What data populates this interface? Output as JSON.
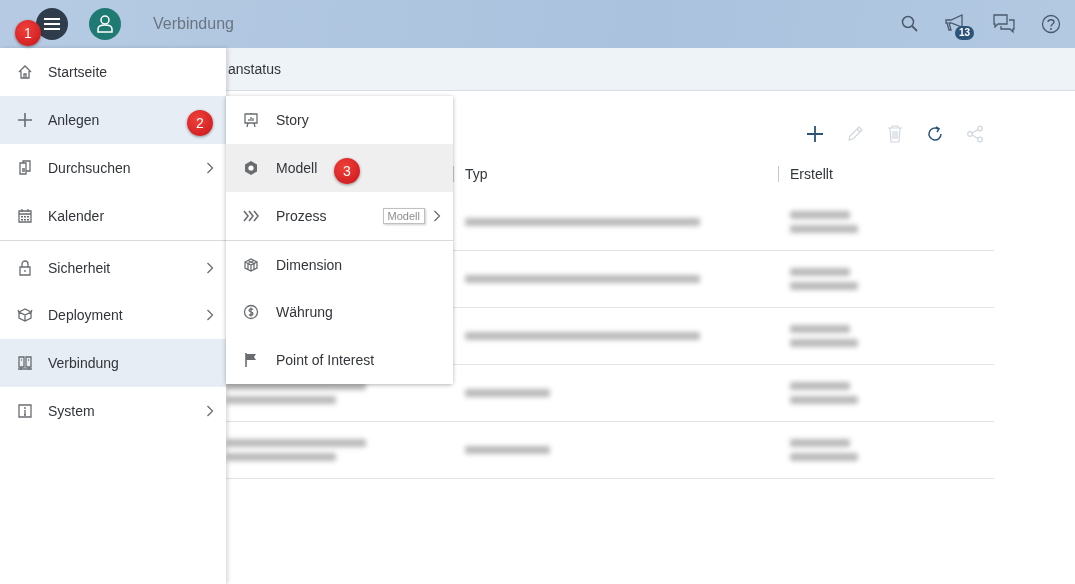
{
  "top_bar": {
    "title": "Verbindung",
    "notification_count": "13"
  },
  "sub_header": {
    "text": "anstatus"
  },
  "nav_menu": {
    "items": [
      {
        "label": "Startseite",
        "selected": false,
        "has_submenu": false,
        "divider_before": false
      },
      {
        "label": "Anlegen",
        "selected": true,
        "has_submenu": false,
        "divider_before": false
      },
      {
        "label": "Durchsuchen",
        "selected": false,
        "has_submenu": true,
        "divider_before": false
      },
      {
        "label": "Kalender",
        "selected": false,
        "has_submenu": false,
        "divider_before": false
      },
      {
        "label": "Sicherheit",
        "selected": false,
        "has_submenu": true,
        "divider_before": true
      },
      {
        "label": "Deployment",
        "selected": false,
        "has_submenu": true,
        "divider_before": false
      },
      {
        "label": "Verbindung",
        "selected": true,
        "has_submenu": false,
        "divider_before": false
      },
      {
        "label": "System",
        "selected": false,
        "has_submenu": true,
        "divider_before": false
      }
    ]
  },
  "submenu": {
    "items": [
      {
        "label": "Story",
        "selected": false,
        "has_submenu": false,
        "divider_before": false
      },
      {
        "label": "Modell",
        "selected": true,
        "has_submenu": false,
        "divider_before": false
      },
      {
        "label": "Prozess",
        "selected": false,
        "has_submenu": true,
        "divider_before": false,
        "tooltip": "Modell"
      },
      {
        "label": "Dimension",
        "selected": false,
        "has_submenu": false,
        "divider_before": true
      },
      {
        "label": "Währung",
        "selected": false,
        "has_submenu": false,
        "divider_before": false
      },
      {
        "label": "Point of Interest",
        "selected": false,
        "has_submenu": false,
        "divider_before": false
      }
    ]
  },
  "toolbar": [
    {
      "kind": "add",
      "disabled": false
    },
    {
      "kind": "edit",
      "disabled": true
    },
    {
      "kind": "delete",
      "disabled": true
    },
    {
      "kind": "refresh",
      "disabled": false
    },
    {
      "kind": "share",
      "disabled": true
    }
  ],
  "table": {
    "columns": [
      "Typ",
      "Erstellt"
    ],
    "rows": [
      {
        "kind": "blurred"
      },
      {
        "kind": "blurred"
      },
      {
        "kind": "blurred"
      },
      {
        "kind": "blurred"
      },
      {
        "kind": "blurred"
      }
    ]
  },
  "step_markers": [
    "1",
    "2",
    "3"
  ]
}
